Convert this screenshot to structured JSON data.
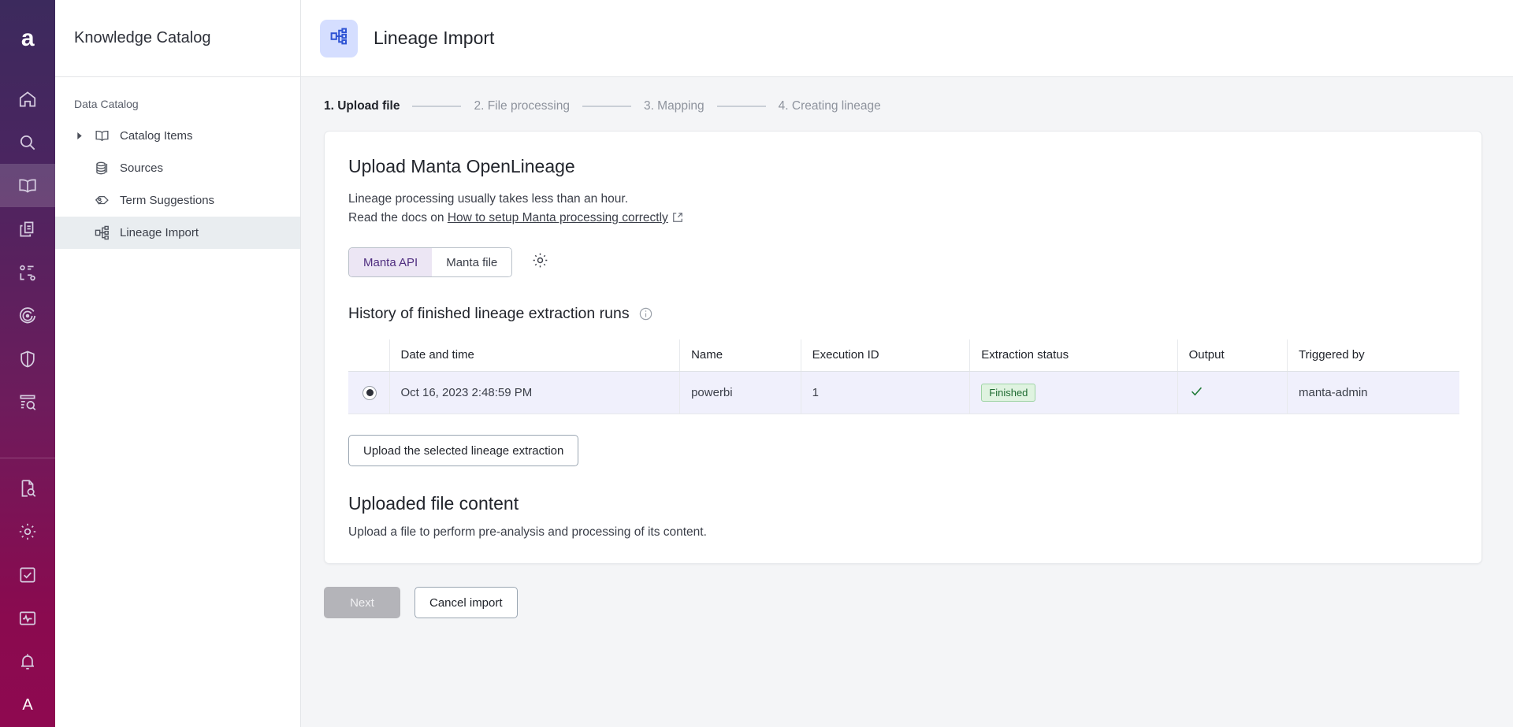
{
  "brand": {
    "wordmark": "a",
    "avatar_initial": "A"
  },
  "rail": {
    "items": [
      {
        "name": "home-icon",
        "label": "Home",
        "active": false
      },
      {
        "name": "search-icon",
        "label": "Search",
        "active": false
      },
      {
        "name": "book-icon",
        "label": "Knowledge Catalog",
        "active": true
      },
      {
        "name": "projects-icon",
        "label": "Projects",
        "active": false
      },
      {
        "name": "deployments-icon",
        "label": "Deployments",
        "active": false
      },
      {
        "name": "target-icon",
        "label": "Data Fabric",
        "active": false
      },
      {
        "name": "shield-icon",
        "label": "Governance",
        "active": false
      },
      {
        "name": "data-quality-icon",
        "label": "Data Quality",
        "active": false
      }
    ],
    "bottom_items": [
      {
        "name": "document-search-icon",
        "label": "Documentation"
      },
      {
        "name": "gear-icon",
        "label": "Administration"
      },
      {
        "name": "tasks-icon",
        "label": "Tasks"
      },
      {
        "name": "monitor-icon",
        "label": "Monitoring"
      },
      {
        "name": "bell-icon",
        "label": "Notifications"
      }
    ]
  },
  "sidebar": {
    "title": "Knowledge Catalog",
    "section_label": "Data Catalog",
    "items": [
      {
        "label": "Catalog Items",
        "icon": "book-open-icon",
        "has_caret": true,
        "selected": false
      },
      {
        "label": "Sources",
        "icon": "database-icon",
        "has_caret": false,
        "selected": false
      },
      {
        "label": "Term Suggestions",
        "icon": "tag-icon",
        "has_caret": false,
        "selected": false
      },
      {
        "label": "Lineage Import",
        "icon": "lineage-icon",
        "has_caret": false,
        "selected": true
      }
    ]
  },
  "header": {
    "title": "Lineage Import",
    "icon": "lineage-icon"
  },
  "stepper": {
    "steps": [
      {
        "label": "1. Upload file",
        "current": true
      },
      {
        "label": "2. File processing",
        "current": false
      },
      {
        "label": "3. Mapping",
        "current": false
      },
      {
        "label": "4. Creating lineage",
        "current": false
      }
    ]
  },
  "card": {
    "heading": "Upload Manta OpenLineage",
    "sub_line1": "Lineage processing usually takes less than an hour.",
    "sub_line2_prefix": "Read the docs on ",
    "sub_line2_link": "How to setup Manta processing correctly",
    "segmented": {
      "options": [
        {
          "label": "Manta API",
          "active": true
        },
        {
          "label": "Manta file",
          "active": false
        }
      ],
      "settings_icon": "gear-icon"
    },
    "history_heading": "History of finished lineage extraction runs",
    "history_info_icon": "info-icon",
    "table": {
      "columns": [
        "",
        "Date and time",
        "Name",
        "Execution ID",
        "Extraction status",
        "Output",
        "Triggered by"
      ],
      "rows": [
        {
          "selected": true,
          "date_time": "Oct 16, 2023 2:48:59 PM",
          "name": "powerbi",
          "execution_id": "1",
          "extraction_status": "Finished",
          "output": "check-icon",
          "triggered_by": "manta-admin"
        }
      ]
    },
    "upload_button": "Upload the selected lineage extraction",
    "uploaded_heading": "Uploaded file content",
    "uploaded_note": "Upload a file to perform pre-analysis and processing of its content."
  },
  "footer": {
    "next_label": "Next",
    "cancel_label": "Cancel import"
  },
  "colors": {
    "rail_top": "#3c2a5d",
    "rail_bottom": "#8e0950",
    "accent_blue": "#2f54d4",
    "accent_blue_bg": "#d5deff",
    "segment_active_bg": "#ece6f4",
    "segment_active_text": "#4f2d7f",
    "badge_bg": "#dff3e0",
    "badge_text": "#1f6b32",
    "row_selected_bg": "#f0f0fc",
    "page_bg": "#f4f5f7"
  }
}
